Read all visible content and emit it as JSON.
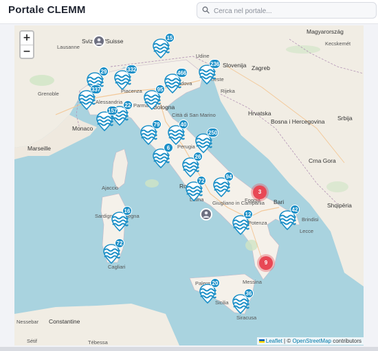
{
  "header": {
    "title": "Portale CLEMM",
    "search_placeholder": "Cerca nel portale..."
  },
  "map": {
    "zoom_in": "+",
    "zoom_out": "−",
    "attribution": {
      "leaflet": "Leaflet",
      "separator": "| ©",
      "osm": "OpenStreetMap",
      "contributors": "contributors"
    },
    "colors": {
      "sea": "#a9d3df",
      "land": "#f1ede4",
      "italy": "#f5f1ea",
      "marker": "#1b8fc7",
      "cluster": "#e84855"
    },
    "place_labels": [
      {
        "text": "Lausanne"
      },
      {
        "text": "Svizzera/Suisse"
      },
      {
        "text": "Magyarország"
      },
      {
        "text": "Kecskemét"
      },
      {
        "text": "Udine"
      },
      {
        "text": "Slovenija"
      },
      {
        "text": "Zagreb"
      },
      {
        "text": "Grenoble"
      },
      {
        "text": "Piacenza"
      },
      {
        "text": "Padova"
      },
      {
        "text": "Trieste"
      },
      {
        "text": "Rijeka"
      },
      {
        "text": "Alessandria"
      },
      {
        "text": "Parma"
      },
      {
        "text": "Bologna"
      },
      {
        "text": "Città di San Marino"
      },
      {
        "text": "Hrvatska"
      },
      {
        "text": "Srbija"
      },
      {
        "text": "Monaco"
      },
      {
        "text": "Perugia"
      },
      {
        "text": "Bosna i Hercegovina"
      },
      {
        "text": "Marseille"
      },
      {
        "text": "Ajaccio"
      },
      {
        "text": "Crna Gora"
      },
      {
        "text": "Roma"
      },
      {
        "text": "Latina"
      },
      {
        "text": "Giugliano in Campania"
      },
      {
        "text": "Foggia"
      },
      {
        "text": "Bari"
      },
      {
        "text": "Brindisi"
      },
      {
        "text": "Shqipëria"
      },
      {
        "text": "Potenza"
      },
      {
        "text": "Lecce"
      },
      {
        "text": "Sardigna/Sardegna"
      },
      {
        "text": "Cagliari"
      },
      {
        "text": "Messina"
      },
      {
        "text": "Palermo"
      },
      {
        "text": "Sicilia"
      },
      {
        "text": "Siracusa"
      },
      {
        "text": "Constantine"
      },
      {
        "text": "Tébessa"
      },
      {
        "text": "Sétif"
      },
      {
        "text": "Nessebar"
      }
    ],
    "markers": [
      {
        "count": "15"
      },
      {
        "count": "29"
      },
      {
        "count": "332"
      },
      {
        "count": "466"
      },
      {
        "count": "236"
      },
      {
        "count": "337"
      },
      {
        "count": "95"
      },
      {
        "count": "22"
      },
      {
        "count": "157"
      },
      {
        "count": "79"
      },
      {
        "count": "40"
      },
      {
        "count": "250"
      },
      {
        "count": "6"
      },
      {
        "count": "26"
      },
      {
        "count": "94"
      },
      {
        "count": "72"
      },
      {
        "count": "12"
      },
      {
        "count": "42"
      },
      {
        "count": "16"
      },
      {
        "count": "72"
      },
      {
        "count": "20"
      },
      {
        "count": "36"
      }
    ],
    "clusters": [
      {
        "count": "3"
      },
      {
        "count": "9"
      }
    ],
    "user_markers": 2
  }
}
